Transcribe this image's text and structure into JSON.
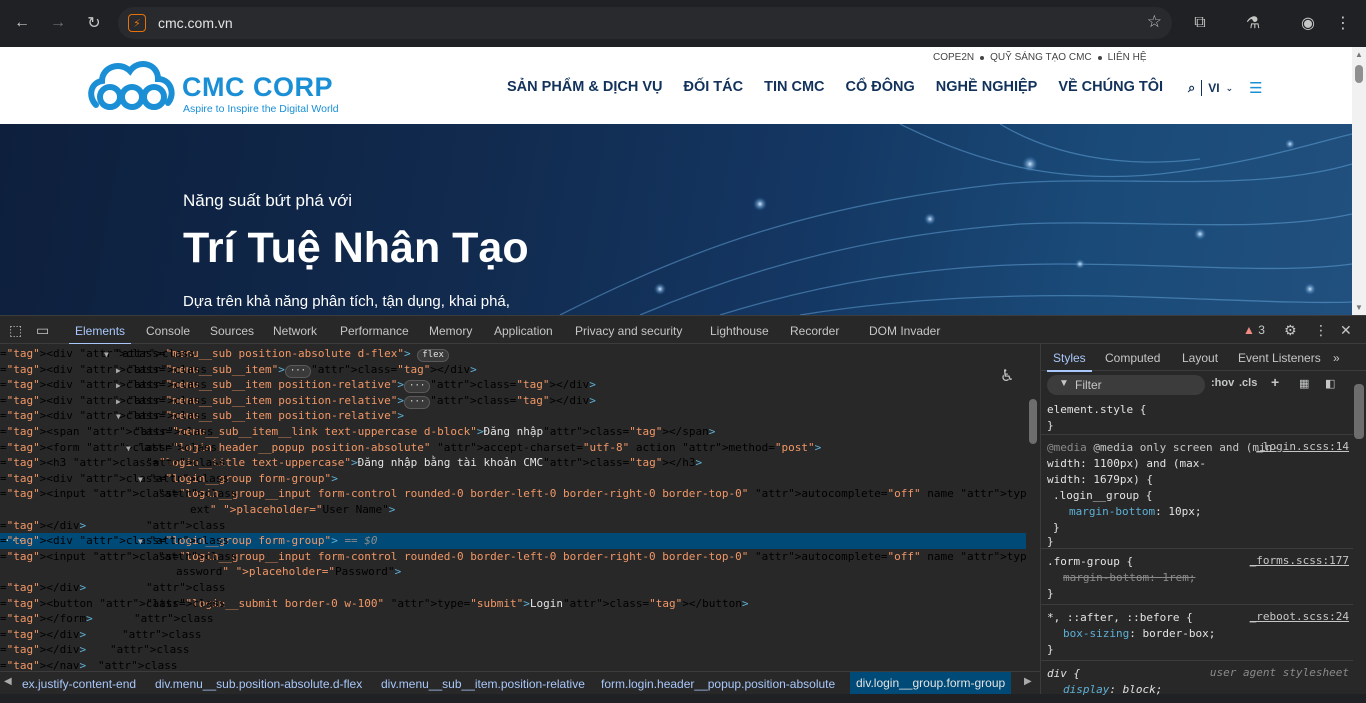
{
  "browser": {
    "url": "cmc.com.vn"
  },
  "site": {
    "brand": "CMC CORP",
    "tagline": "Aspire to Inspire the Digital World",
    "top_links": [
      "COPE2N",
      "QUỸ SÁNG TẠO CMC",
      "LIÊN HỆ"
    ],
    "main_nav": [
      "SẢN PHẨM & DỊCH VỤ",
      "ĐỐI TÁC",
      "TIN CMC",
      "CỔ ĐÔNG",
      "NGHỀ NGHIỆP",
      "VỀ CHÚNG TÔI"
    ],
    "lang": "VI",
    "hero": {
      "sub": "Năng suất bứt phá với",
      "title": "Trí Tuệ Nhân Tạo",
      "desc": "Dựa trên khả năng phân tích, tận dụng, khai phá,"
    }
  },
  "devtools": {
    "tabs": [
      "Elements",
      "Console",
      "Sources",
      "Network",
      "Performance",
      "Memory",
      "Application",
      "Privacy and security",
      "Lighthouse",
      "Recorder",
      "DOM Invader"
    ],
    "warnings": "3",
    "dom_lines": [
      {
        "t": "<div class=\"menu__sub position-absolute d-flex\">",
        "badge": "flex"
      },
      {
        "t": "<div class=\"menu__sub__item\">",
        "ell": true,
        "close": "</div>"
      },
      {
        "t": "<div class=\"menu__sub__item position-relative\">",
        "ell": true,
        "close": "</div>"
      },
      {
        "t": "<div class=\"menu__sub__item position-relative\">",
        "ell": true,
        "close": "</div>"
      },
      {
        "t": "<div class=\"menu__sub__item position-relative\">"
      },
      {
        "t": "<span class=\"menu__sub__item__link text-uppercase d-block\">",
        "text": "Đăng nhập",
        "close": "</span>"
      },
      {
        "t": "<form class=\"login header__popup position-absolute\" accept-charset=\"utf-8\" action method=\"post\">"
      },
      {
        "t": "<h3 class=\"login__title text-uppercase\">",
        "text": "Đăng nhập bằng tài khoản CMC",
        "close": "</h3>"
      },
      {
        "t": "<div class=\"login__group form-group\">"
      },
      {
        "t": "<input class=\"login__group__input form-control rounded-0 border-left-0 border-right-0 border-top-0\" autocomplete=\"off\" name type=\"t"
      },
      {
        "t": "ext\" placeholder=\"User Name\">"
      },
      {
        "t": "</div>"
      },
      {
        "t": "<div class=\"login__group form-group\">",
        "sel": true,
        "dollar": "== $0"
      },
      {
        "t": "<input class=\"login__group__input form-control rounded-0 border-left-0 border-right-0 border-top-0\" autocomplete=\"off\" name type=\"p"
      },
      {
        "t": "assword\" placeholder=\"Password\">"
      },
      {
        "t": "</div>"
      },
      {
        "t": "<button class=\"login__submit border-0 w-100\" type=\"submit\">",
        "text": "Login",
        "close": "</button>"
      },
      {
        "t": "</form>"
      },
      {
        "t": "</div>"
      },
      {
        "t": "</div>"
      },
      {
        "t": "</nav>"
      }
    ],
    "breadcrumbs": [
      "ex.justify-content-end",
      "div.menu__sub.position-absolute.d-flex",
      "div.menu__sub__item.position-relative",
      "form.login.header__popup.position-absolute",
      "div.login__group.form-group"
    ],
    "styles_tabs": [
      "Styles",
      "Computed",
      "Layout",
      "Event Listeners"
    ],
    "filter_placeholder": "Filter",
    "hov": ":hov",
    "cls": ".cls",
    "rules": {
      "r1": {
        "line1": "element.style {",
        "line2": "}"
      },
      "r2": {
        "line1": "@media only screen and (min-",
        "line2": "width: 1100px) and (max-",
        "line3": "width: 1679px) {",
        "sel": ".login__group {",
        "prop": "margin-bottom",
        "val": "10px;",
        "src": "_login.scss:14"
      },
      "r3": {
        "sel": ".form-group {",
        "prop": "margin-bottom",
        "val": "1rem;",
        "src": "_forms.scss:177"
      },
      "r4": {
        "sel": "*, ::after, ::before {",
        "prop": "box-sizing",
        "val": "border-box;",
        "src": "_reboot.scss:24"
      },
      "r5": {
        "sel": "div {",
        "prop": "display",
        "val": "block;",
        "src": "user agent stylesheet"
      }
    }
  }
}
